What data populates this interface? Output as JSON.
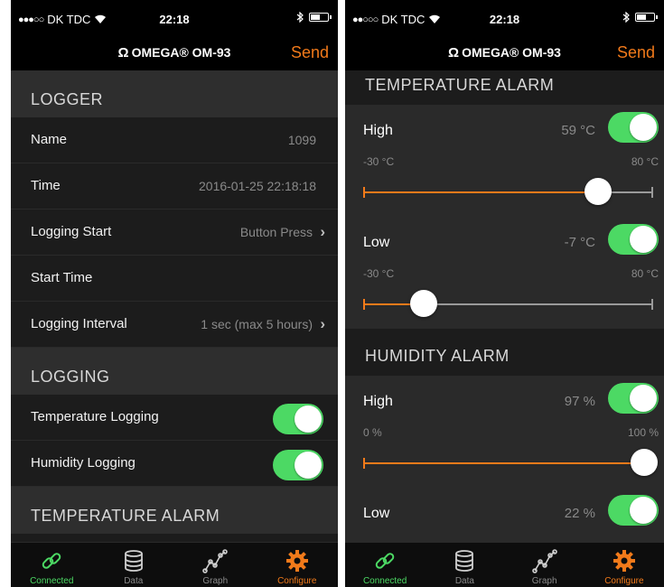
{
  "status_bar": {
    "carrier": "DK TDC",
    "time": "22:18"
  },
  "nav": {
    "title": "OMEGA® OM-93",
    "send_label": "Send"
  },
  "left_screen": {
    "logger_header": "LOGGER",
    "logger_rows": [
      {
        "label": "Name",
        "value": "1099",
        "chevron": false
      },
      {
        "label": "Time",
        "value": "2016-01-25 22:18:18",
        "chevron": false
      },
      {
        "label": "Logging Start",
        "value": "Button Press",
        "chevron": true
      },
      {
        "label": "Start Time",
        "value": "",
        "chevron": false
      },
      {
        "label": "Logging Interval",
        "value": "1 sec (max 5 hours)",
        "chevron": true
      }
    ],
    "logging_header": "LOGGING",
    "logging_rows": [
      {
        "label": "Temperature Logging",
        "on": true
      },
      {
        "label": "Humidity Logging",
        "on": true
      }
    ],
    "temp_alarm_header": "TEMPERATURE ALARM"
  },
  "right_screen": {
    "temp_alarm_header": "TEMPERATURE ALARM",
    "temp_high": {
      "label": "High",
      "value": "59 °C",
      "min": "-30 °C",
      "max": "80 °C",
      "on": true,
      "level": 0.81
    },
    "temp_low": {
      "label": "Low",
      "value": "-7 °C",
      "min": "-30 °C",
      "max": "80 °C",
      "on": true,
      "level": 0.21
    },
    "humidity_alarm_header": "HUMIDITY ALARM",
    "hum_high": {
      "label": "High",
      "value": "97 %",
      "min": "0 %",
      "max": "100 %",
      "on": true,
      "level": 0.97
    },
    "hum_low": {
      "label": "Low",
      "value": "22 %",
      "on": true
    }
  },
  "tabs": [
    {
      "label": "Connected",
      "icon": "link-icon",
      "state": "connected"
    },
    {
      "label": "Data",
      "icon": "database-icon",
      "state": "normal"
    },
    {
      "label": "Graph",
      "icon": "graph-icon",
      "state": "normal"
    },
    {
      "label": "Configure",
      "icon": "gear-icon",
      "state": "active"
    }
  ],
  "colors": {
    "accent": "#f27a1a",
    "toggle_on": "#4cd964",
    "background": "#1c1c1c",
    "section": "#2e2e2e"
  }
}
